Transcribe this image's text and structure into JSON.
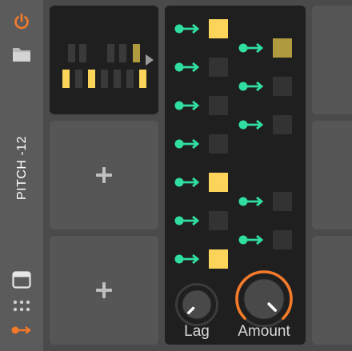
{
  "sidebar": {
    "device_name": "PITCH -12",
    "icons": [
      "power-icon",
      "folder-icon",
      "window-icon",
      "grid-dots-icon",
      "modulator-arrow-icon"
    ]
  },
  "steps": {
    "left": [
      true,
      false,
      false,
      false,
      true,
      false,
      true
    ],
    "right": [
      true,
      false,
      false,
      false,
      false
    ]
  },
  "knobs": {
    "lag": {
      "label": "Lag",
      "value": 0.0
    },
    "amount": {
      "label": "Amount",
      "value": 1.0
    }
  },
  "colors": {
    "accent_orange": "#f47a2a",
    "step_on": "#fcd45a",
    "step_dim": "#b09a40",
    "link_green": "#30dfa0"
  }
}
